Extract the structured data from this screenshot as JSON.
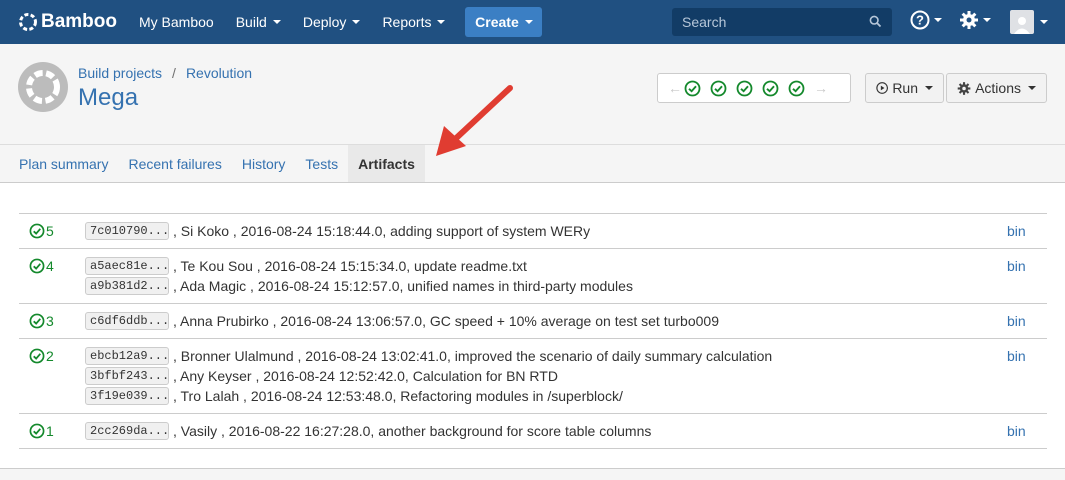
{
  "nav": {
    "logo": "Bamboo",
    "items": [
      {
        "label": "My Bamboo",
        "caret": false
      },
      {
        "label": "Build",
        "caret": true
      },
      {
        "label": "Deploy",
        "caret": true
      },
      {
        "label": "Reports",
        "caret": true
      }
    ],
    "create_label": "Create",
    "search_placeholder": "Search",
    "icons": [
      "help-icon",
      "gear-icon",
      "user-avatar-icon"
    ]
  },
  "header": {
    "breadcrumb": [
      "Build projects",
      "Revolution"
    ],
    "title": "Mega",
    "recent_builds_status": [
      "success",
      "success",
      "success",
      "success",
      "success"
    ],
    "run_label": "Run",
    "actions_label": "Actions"
  },
  "tabs": [
    {
      "label": "Plan summary",
      "active": false
    },
    {
      "label": "Recent failures",
      "active": false
    },
    {
      "label": "History",
      "active": false
    },
    {
      "label": "Tests",
      "active": false
    },
    {
      "label": "Artifacts",
      "active": true
    }
  ],
  "builds": [
    {
      "number": "5",
      "artifact": "bin",
      "changes": [
        {
          "hash": "7c010790...",
          "text": ", Si Koko , 2016-08-24 15:18:44.0, adding support of system WERy"
        }
      ]
    },
    {
      "number": "4",
      "artifact": "bin",
      "changes": [
        {
          "hash": "a5aec81e...",
          "text": ", Te Kou Sou , 2016-08-24 15:15:34.0, update readme.txt"
        },
        {
          "hash": "a9b381d2...",
          "text": ", Ada Magic , 2016-08-24 15:12:57.0, unified names in third-party modules"
        }
      ]
    },
    {
      "number": "3",
      "artifact": "bin",
      "changes": [
        {
          "hash": "c6df6ddb...",
          "text": ", Anna Prubirko , 2016-08-24 13:06:57.0, GC speed + 10% average on test set turbo009"
        }
      ]
    },
    {
      "number": "2",
      "artifact": "bin",
      "changes": [
        {
          "hash": "ebcb12a9...",
          "text": ", Bronner Ulalmund , 2016-08-24 13:02:41.0, improved the scenario of daily summary calculation"
        },
        {
          "hash": "3bfbf243...",
          "text": ", Any Keyser , 2016-08-24 12:52:42.0, Calculation for BN RTD"
        },
        {
          "hash": "3f19e039...",
          "text": ", Tro Lalah , 2016-08-24 12:53:48.0, Refactoring modules in /superblock/"
        }
      ]
    },
    {
      "number": "1",
      "artifact": "bin",
      "changes": [
        {
          "hash": "2cc269da...",
          "text": ", Vasily , 2016-08-22 16:27:28.0, another background for score table columns"
        }
      ]
    }
  ],
  "colors": {
    "nav_bg": "#205081",
    "link": "#3572b0",
    "success": "#14892c",
    "annotation_arrow": "#e03c31"
  }
}
